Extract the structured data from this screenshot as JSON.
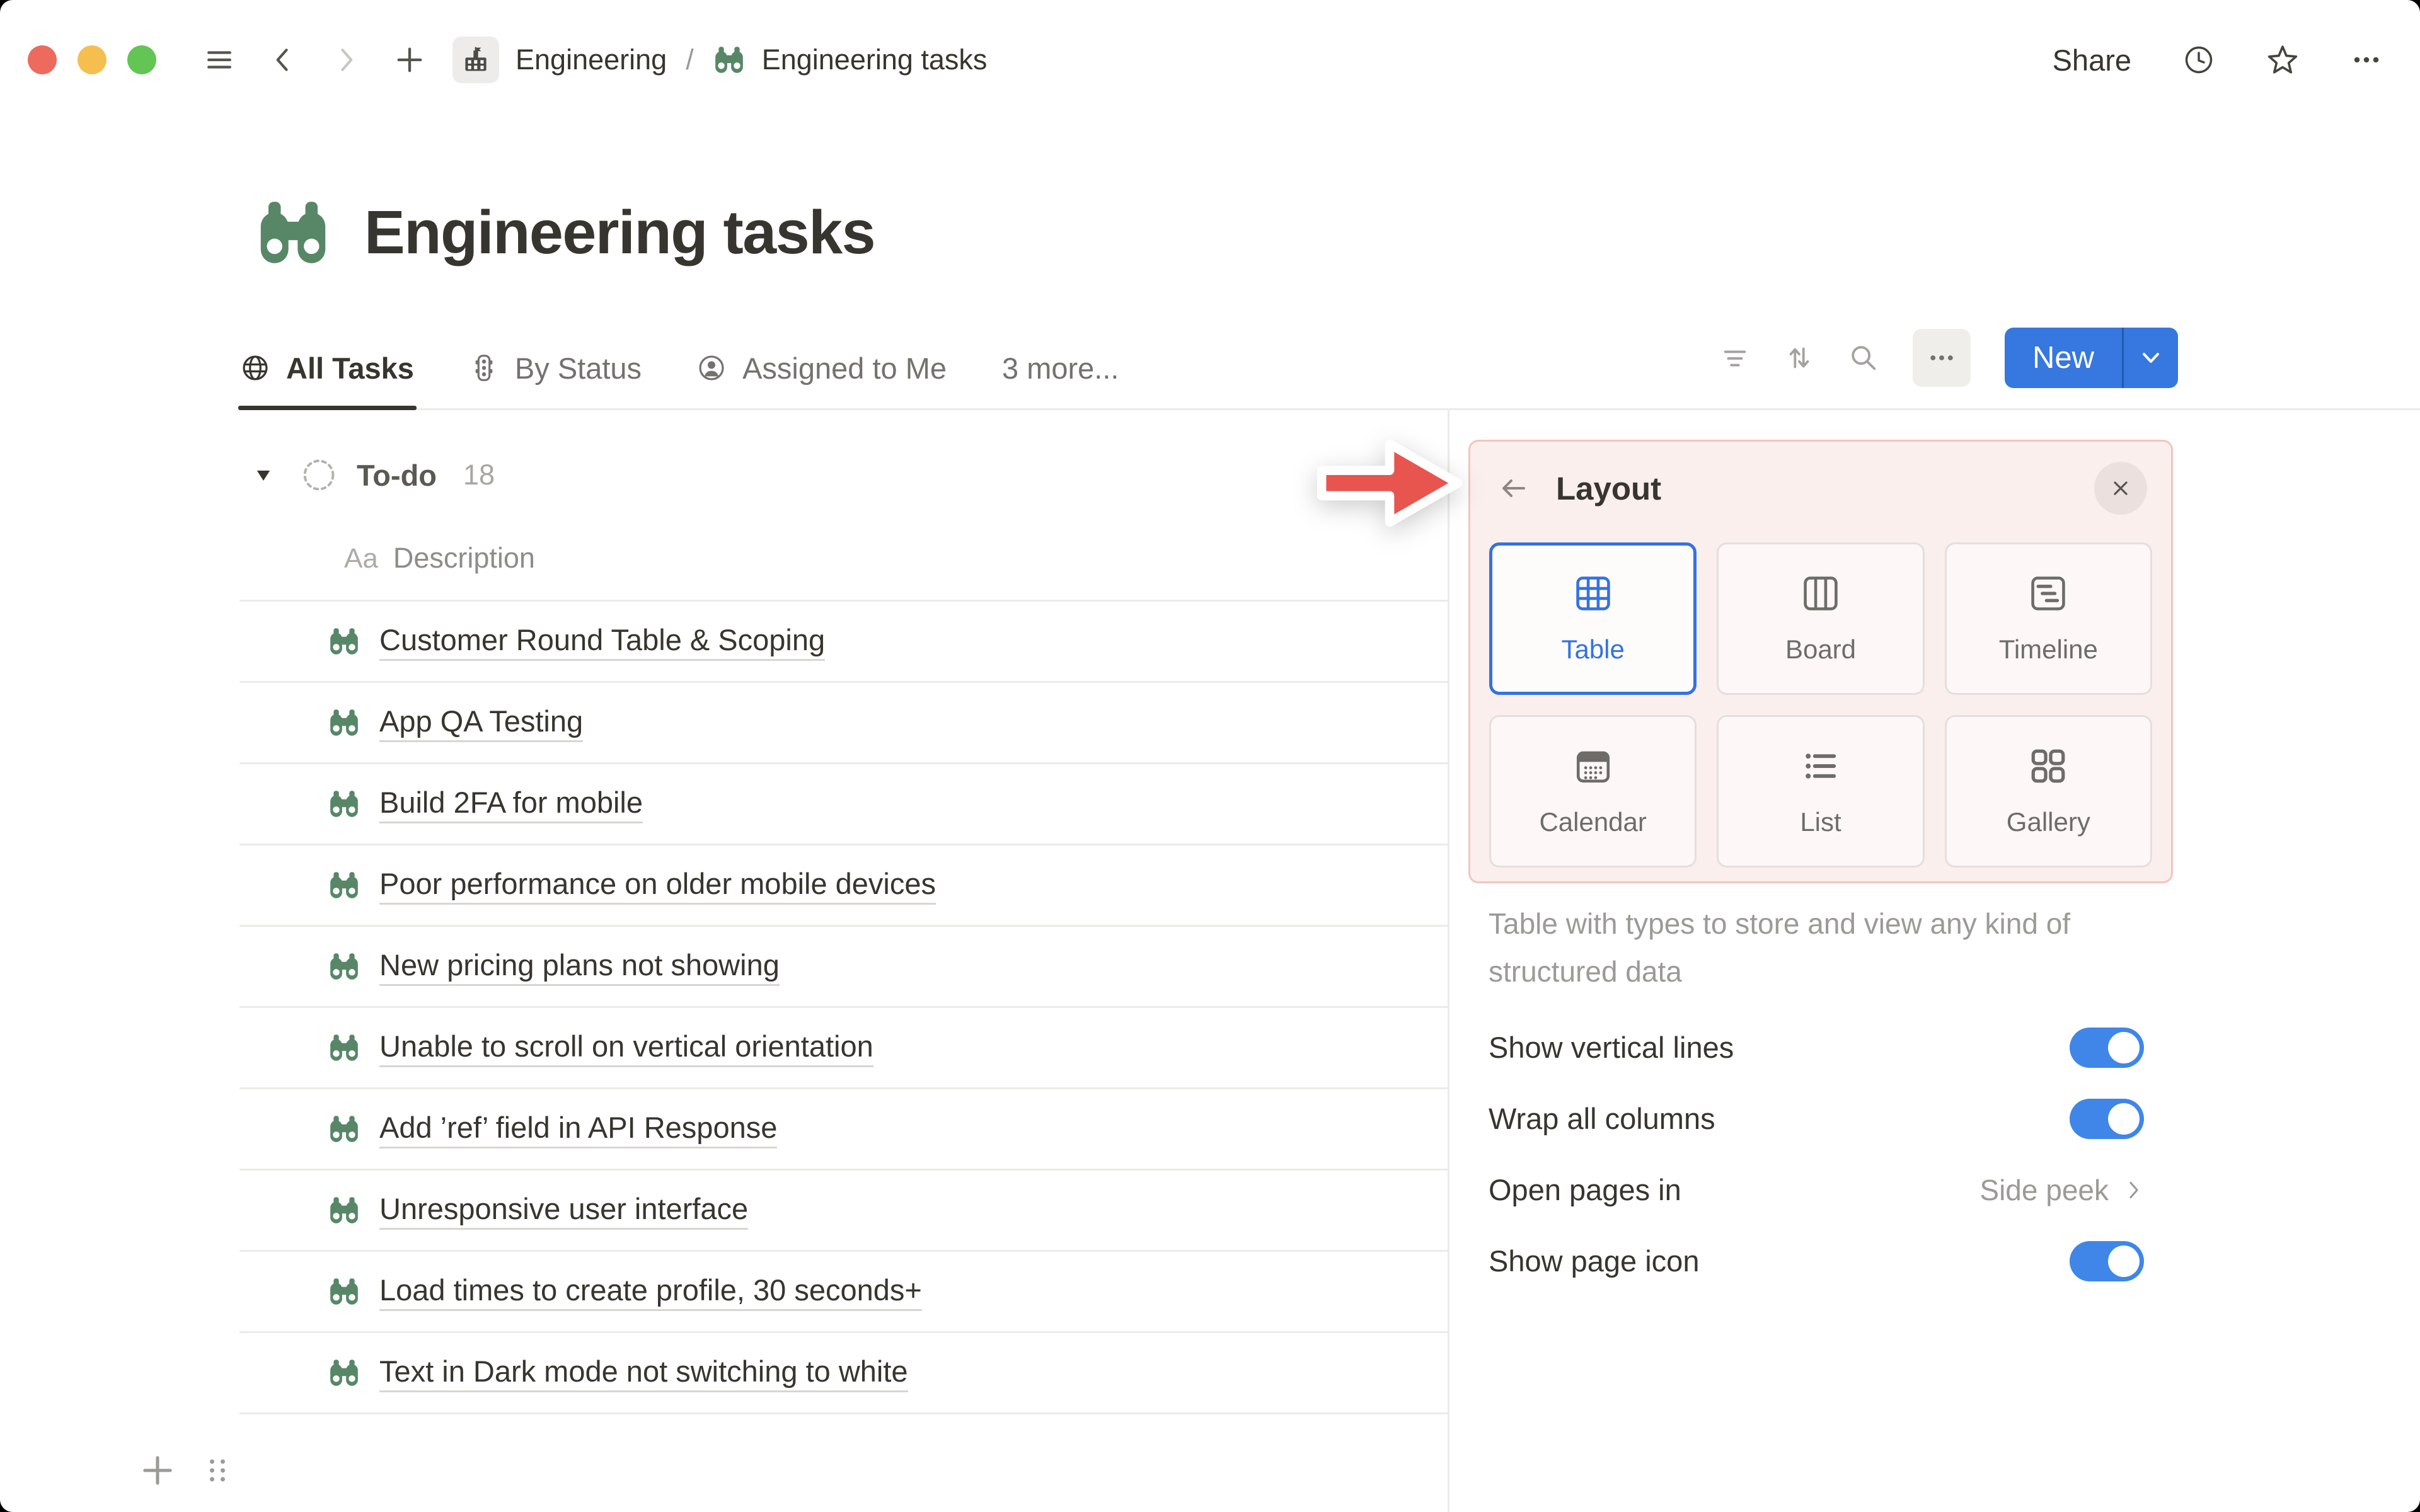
{
  "colors": {
    "accent_blue": "#3677E0",
    "toggle_blue": "#3F86E8",
    "selected_option_blue": "#3472E2",
    "icon_green": "#578767",
    "annotation_red": "#E8554E",
    "panel_highlight_bg": "#FBEFED",
    "panel_highlight_border": "#F2C5BF",
    "traffic_red": "#ED6A5E",
    "traffic_yellow": "#F5BF4F",
    "traffic_green": "#62C554"
  },
  "icons": {
    "nav": [
      "hamburger-icon",
      "chevron-left-icon",
      "chevron-right-icon",
      "plus-icon"
    ],
    "breadcrumb": [
      "building-icon",
      "binoculars-icon"
    ],
    "top_actions": [
      "clock-icon",
      "star-icon",
      "more-icon"
    ],
    "toolbar": [
      "filter-icon",
      "sort-icon",
      "search-icon",
      "more-icon",
      "chevron-down-icon"
    ],
    "group": [
      "triangle-down-icon",
      "dashed-circle-icon"
    ],
    "row": [
      "binoculars-icon"
    ],
    "panel": [
      "back-arrow-icon",
      "close-icon",
      "table-icon",
      "board-icon",
      "timeline-icon",
      "calendar-icon",
      "list-icon",
      "gallery-icon",
      "chevron-right-icon"
    ],
    "footer": [
      "plus-icon",
      "drag-handle-icon"
    ],
    "annotation": [
      "red-arrow"
    ]
  },
  "topbar": {
    "breadcrumb": {
      "parent": "Engineering",
      "separator": "/",
      "page": "Engineering tasks"
    },
    "share_label": "Share"
  },
  "page": {
    "title": "Engineering tasks"
  },
  "tabs": [
    {
      "label": "All Tasks",
      "icon": "globe-icon",
      "active": true
    },
    {
      "label": "By Status",
      "icon": "traffic-light-icon",
      "active": false
    },
    {
      "label": "Assigned to Me",
      "icon": "person-icon",
      "active": false
    },
    {
      "label": "3 more...",
      "icon": null,
      "active": false
    }
  ],
  "toolbar": {
    "new_label": "New"
  },
  "table": {
    "group": {
      "name": "To-do",
      "count": "18"
    },
    "column_header": {
      "type": "Aa",
      "label": "Description"
    },
    "rows": [
      "Customer Round Table & Scoping",
      "App QA Testing",
      "Build 2FA for mobile",
      "Poor performance on older mobile devices",
      "New pricing plans not showing",
      "Unable to scroll on vertical orientation",
      "Add ’ref’ field in API Response",
      "Unresponsive user interface",
      "Load times to create profile, 30 seconds+",
      "Text in Dark mode not switching to white"
    ]
  },
  "layout_panel": {
    "title": "Layout",
    "options": [
      {
        "label": "Table",
        "icon": "table-icon",
        "selected": true
      },
      {
        "label": "Board",
        "icon": "board-icon",
        "selected": false
      },
      {
        "label": "Timeline",
        "icon": "timeline-icon",
        "selected": false
      },
      {
        "label": "Calendar",
        "icon": "calendar-icon",
        "selected": false
      },
      {
        "label": "List",
        "icon": "list-icon",
        "selected": false
      },
      {
        "label": "Gallery",
        "icon": "gallery-icon",
        "selected": false
      }
    ],
    "description": "Table with types to store and view any kind of structured data",
    "settings": [
      {
        "label": "Show vertical lines",
        "control": "toggle",
        "value": true
      },
      {
        "label": "Wrap all columns",
        "control": "toggle",
        "value": true
      },
      {
        "label": "Open pages in",
        "control": "disclosure",
        "value": "Side peek"
      },
      {
        "label": "Show page icon",
        "control": "toggle",
        "value": true
      }
    ]
  }
}
